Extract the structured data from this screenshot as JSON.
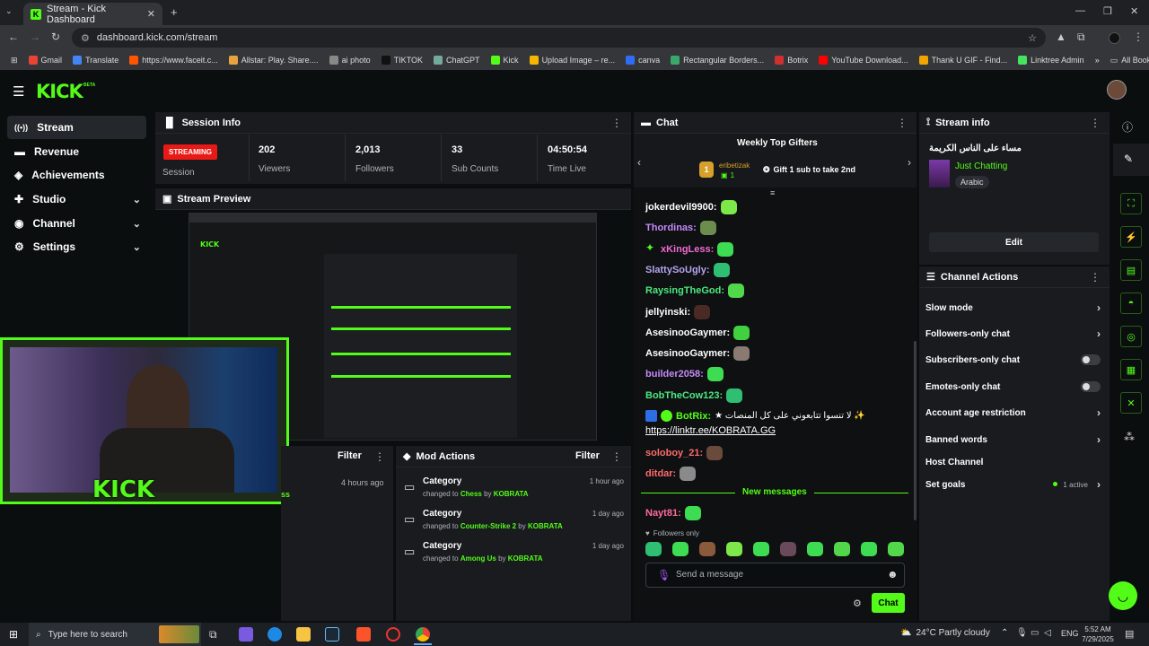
{
  "browser": {
    "tab_title": "Stream - Kick Dashboard",
    "url": "dashboard.kick.com/stream",
    "bookmarks": [
      "Gmail",
      "Translate",
      "https://www.faceit.c...",
      "Allstar: Play. Share....",
      "ai photo",
      "TIKTOK",
      "ChatGPT",
      "Kick",
      "Upload Image – re...",
      "canva",
      "Rectangular Borders...",
      "Botrix",
      "YouTube Download...",
      "Thank U GIF - Find...",
      "Linktree Admin"
    ],
    "all_bookmarks": "All Bookmarks",
    "bookmark_colors": [
      "#ea4335",
      "#4285f4",
      "#ff5500",
      "#e8a33d",
      "#888888",
      "#111111",
      "#74aa9c",
      "#53fc18",
      "#f7b500",
      "#2f6df6",
      "#3aa76d",
      "#d03030",
      "#ff0000",
      "#f0a500",
      "#43e55e"
    ]
  },
  "kick": {
    "logo": "KICK",
    "beta": "BETA"
  },
  "sidebar": {
    "items": [
      {
        "label": "Stream",
        "icon": "stream-icon",
        "active": true
      },
      {
        "label": "Revenue",
        "icon": "revenue-icon"
      },
      {
        "label": "Achievements",
        "icon": "achievements-icon"
      },
      {
        "label": "Studio",
        "icon": "studio-icon",
        "expandable": true
      },
      {
        "label": "Channel",
        "icon": "channel-icon",
        "expandable": true
      },
      {
        "label": "Settings",
        "icon": "gear-icon",
        "expandable": true
      }
    ]
  },
  "session": {
    "title": "Session Info",
    "status": "STREAMING",
    "status_label": "Session",
    "stats": [
      {
        "value": "202",
        "label": "Viewers"
      },
      {
        "value": "2,013",
        "label": "Followers"
      },
      {
        "value": "33",
        "label": "Sub Counts"
      },
      {
        "value": "04:50:54",
        "label": "Time Live"
      }
    ]
  },
  "preview": {
    "title": "Stream Preview"
  },
  "activity": {
    "filter": "Filter",
    "time": "4 hours ago",
    "fragment": "ss"
  },
  "mod_actions": {
    "title": "Mod Actions",
    "filter": "Filter",
    "rows": [
      {
        "title": "Category",
        "prefix": "changed to",
        "target": "Chess",
        "by": "by",
        "user": "KOBRATA",
        "time": "1 hour ago"
      },
      {
        "title": "Category",
        "prefix": "changed to",
        "target": "Counter-Strike 2",
        "by": "by",
        "user": "KOBRATA",
        "time": "1 day ago"
      },
      {
        "title": "Category",
        "prefix": "changed to",
        "target": "Among Us",
        "by": "by",
        "user": "KOBRATA",
        "time": "1 day ago"
      }
    ]
  },
  "chat": {
    "title": "Chat",
    "gifters_title": "Weekly Top Gifters",
    "gifter_rank": "1",
    "gifter_name": "eribetizak",
    "gifter_count": "1",
    "gift_cta": "Gift 1 sub to take 2nd",
    "messages": [
      {
        "user": "jokerdevil9900:",
        "color": "#ffffff",
        "emote": "#7de84a"
      },
      {
        "user": "Thordinas:",
        "color": "#c58af9",
        "emote": "#6b8e4e"
      },
      {
        "user": "xKingLess:",
        "color": "#f06bd6",
        "emote": "#3ddc52"
      },
      {
        "user": "SlattySoUgly:",
        "color": "#b6a6f0",
        "emote": "#2fbf72"
      },
      {
        "user": "RaysingTheGod:",
        "color": "#4de87f",
        "emote": "#52d64a"
      },
      {
        "user": "jellyinski:",
        "color": "#ffffff",
        "emote": "#4a2a24"
      },
      {
        "user": "AsesinooGaymer:",
        "color": "#ffffff",
        "emote": "#40d040"
      },
      {
        "user": "AsesinooGaymer:",
        "color": "#ffffff",
        "emote": "#8a7a72"
      },
      {
        "user": "builder2058:",
        "color": "#c58af9",
        "emote": "#3ddc52"
      },
      {
        "user": "BobTheCow123:",
        "color": "#4de87f",
        "emote": "#2fbf72"
      }
    ],
    "botrix_user": "BotRix:",
    "botrix_msg": "★ لا تنسوا تتابعوني على كل المنصات ✨",
    "botrix_link": "https://linktr.ee/KOBRATA.GG",
    "after": [
      {
        "user": "soloboy_21:",
        "color": "#ff6b6b",
        "emote": "#6a4a3a"
      },
      {
        "user": "ditdar:",
        "color": "#ff6b6b",
        "emote": "#8a8a8a"
      }
    ],
    "new_messages": "New messages",
    "last": {
      "user": "Nayt81:",
      "color": "#ff6b9a",
      "emote": "#3ddc52"
    },
    "followers_only": "Followers only",
    "emote_tray": [
      "#2fbf72",
      "#3ddc52",
      "#8a5a3a",
      "#7de84a",
      "#3ddc52",
      "#6a4a5a",
      "#3ddc52",
      "#52d64a",
      "#3ddc52",
      "#52d64a"
    ],
    "placeholder": "Send a message",
    "send": "Chat"
  },
  "stream_info": {
    "title": "Stream info",
    "stream_title": "مساء على الناس الكريمة",
    "category": "Just Chatting",
    "tag": "Arabic",
    "edit": "Edit"
  },
  "channel_actions": {
    "title": "Channel Actions",
    "items": [
      {
        "label": "Slow mode",
        "type": "arrow"
      },
      {
        "label": "Followers-only chat",
        "type": "arrow"
      },
      {
        "label": "Subscribers-only chat",
        "type": "toggle"
      },
      {
        "label": "Emotes-only chat",
        "type": "toggle"
      },
      {
        "label": "Account age restriction",
        "type": "arrow"
      },
      {
        "label": "Banned words",
        "type": "arrow"
      },
      {
        "label": "Host Channel",
        "type": "none"
      },
      {
        "label": "Set goals",
        "type": "arrow",
        "status": "1 active"
      }
    ]
  },
  "taskbar": {
    "search": "Type here to search",
    "weather": "24°C  Partly cloudy",
    "lang": "ENG",
    "time": "5:52 AM",
    "date": "7/29/2025"
  }
}
